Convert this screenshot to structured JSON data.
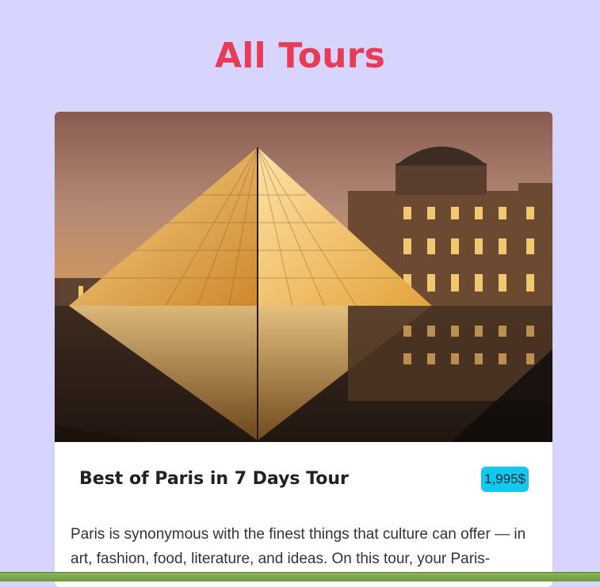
{
  "page": {
    "title": "All Tours"
  },
  "tour": {
    "title": "Best of Paris in 7 Days Tour",
    "price": "1,995$",
    "description": "Paris is synonymous with the finest things that culture can offer — in art, fashion, food, literature, and ideas. On this tour, your Paris-"
  },
  "colors": {
    "background": "#d7d5ff",
    "title": "#e63c55",
    "price_badge": "#12c8f0"
  }
}
